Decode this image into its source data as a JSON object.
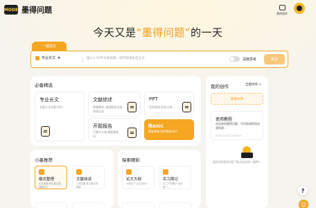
{
  "header": {
    "logo_mark": "MODE",
    "logo_text": "墨得问题",
    "my_works_label": "我的创作"
  },
  "hero": {
    "prefix": "今天又是",
    "highlight": "“墨得问题”",
    "suffix": "的一天"
  },
  "composer": {
    "tab_label": "一键成文",
    "type_select": "专业长文",
    "placeholder": "输入5-50字文章标题，即可快速生成全文",
    "deep_think_label": "深度思考",
    "deep_think_on": false,
    "send_label": "发送"
  },
  "essentials": {
    "title": "必备精选",
    "items": [
      {
        "title": "专业长文",
        "desc": "长篇大论有我不怕～",
        "icon": "document-pen-icon"
      },
      {
        "title": "文献综述",
        "desc": "收集整理, 梳理相关文献,\n快速生成",
        "icon": "book-icon"
      },
      {
        "title": "PPT",
        "desc": "告别熬夜,秒变大神～",
        "icon": "presentation-icon"
      },
      {
        "title": "开题报告",
        "desc": "万事开头难,需要模板\n吗",
        "icon": "report-icon"
      }
    ],
    "aigc": {
      "title": "降AIGC",
      "desc": "精准降重·同时降低AIGC"
    }
  },
  "mini_recommend": {
    "title": "小墨推荐",
    "items": [
      {
        "title": "格式整理",
        "desc": "论文标题不规,格式整\n理服务中"
      },
      {
        "title": "文献阅读",
        "desc": "上传文献,核心要点秒\n提炼"
      }
    ]
  },
  "explore": {
    "title": "探索精彩",
    "items": [
      {
        "title": "论文大纲",
        "desc": "大纲生产,论文无忧～"
      },
      {
        "title": "实习周记",
        "desc": "打工人的周记\"流水\n账\"～"
      }
    ]
  },
  "my_works": {
    "title": "我的创作",
    "view_all": "全部创作 >",
    "new_doc": "新建文件",
    "doc": {
      "title": "使用教程",
      "desc": "欢迎来到墨得问题，写作助理帮您快速构建...",
      "time": "2024-10-21 10:55:27"
    },
    "empty_text": "暂时没有更多内容了哦,快去创作一篇吧～"
  },
  "floating": {
    "help": "?",
    "user": "☺"
  },
  "colors": {
    "accent": "#f5a623",
    "accent_text": "#f29a17",
    "page_bg": "#f6f4ef"
  }
}
